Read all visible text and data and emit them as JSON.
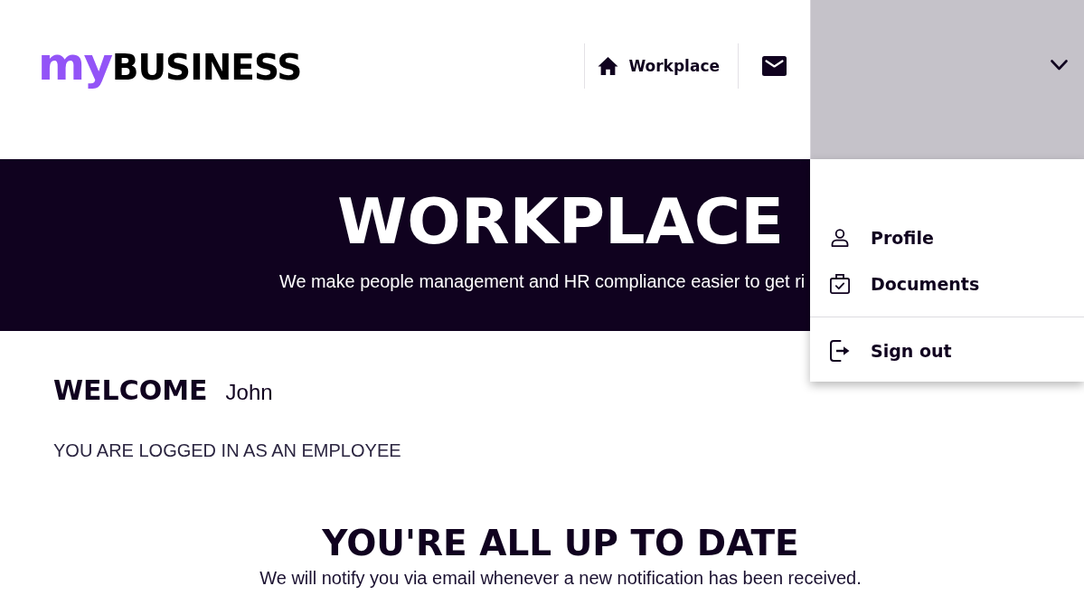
{
  "header": {
    "logo": {
      "prefix": "my",
      "name": "BUSINESS"
    },
    "nav": [
      {
        "kind": "home",
        "label": "Workplace"
      },
      {
        "kind": "mail"
      }
    ],
    "account_menu": {
      "expanded": true,
      "groups": [
        {
          "items": [
            {
              "kind": "profile",
              "label": "Profile"
            },
            {
              "kind": "documents",
              "label": "Documents"
            }
          ]
        },
        {
          "items": [
            {
              "kind": "sign_out",
              "label": "Sign out"
            }
          ]
        }
      ]
    }
  },
  "hero": {
    "title": "WORKPLACE",
    "subtitle": "We make people management and HR compliance easier to get ri"
  },
  "welcome": {
    "heading": "WELCOME",
    "name": "John",
    "role_note": "YOU ARE LOGGED IN AS AN EMPLOYEE"
  },
  "notifications": {
    "heading": "YOU'RE ALL UP TO DATE",
    "message": "We will notify you via email whenever a new notification has been received."
  }
}
